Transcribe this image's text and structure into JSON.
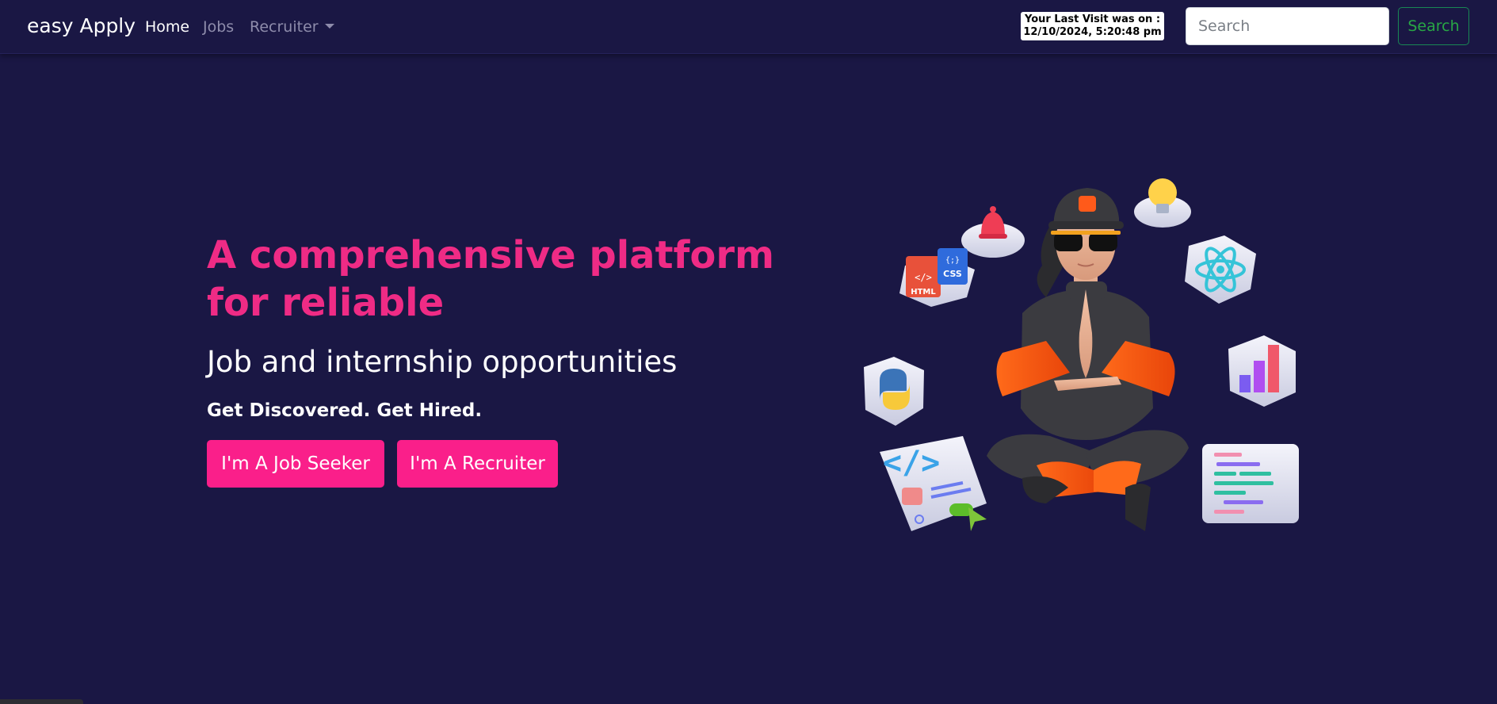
{
  "navbar": {
    "brand": "easy Apply",
    "links": [
      {
        "label": "Home",
        "active": true
      },
      {
        "label": "Jobs",
        "active": false
      },
      {
        "label": "Recruiter",
        "active": false,
        "dropdown": true
      }
    ],
    "last_visit": {
      "line1": "Your Last Visit was on :",
      "line2": "12/10/2024, 5:20:48 pm"
    },
    "search": {
      "placeholder": "Search",
      "button_label": "Search"
    }
  },
  "hero": {
    "title": "A comprehensive platform for reliable",
    "subtitle": "Job and internship opportunities",
    "tagline": "Get Discovered. Get Hired.",
    "buttons": {
      "job_seeker": "I'm A Job Seeker",
      "recruiter": "I'm A Recruiter"
    }
  },
  "illustration": {
    "icons": [
      "bell-icon",
      "lightbulb-icon",
      "html-css-icon",
      "react-icon",
      "python-icon",
      "bar-chart-icon",
      "code-editor-icon",
      "code-window-icon"
    ],
    "labels": {
      "html": "HTML",
      "css": "CSS"
    }
  },
  "colors": {
    "background": "#1a1744",
    "accent": "#fa1f8a",
    "title": "#ef2b85",
    "search_button": "#28a745"
  }
}
